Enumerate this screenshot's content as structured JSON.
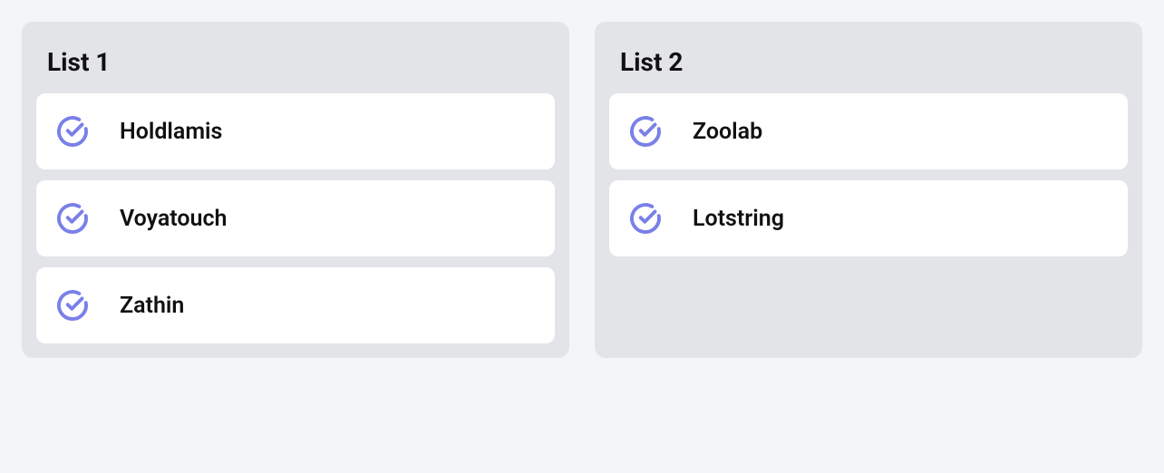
{
  "lists": [
    {
      "title": "List 1",
      "items": [
        {
          "label": "Holdlamis"
        },
        {
          "label": "Voyatouch"
        },
        {
          "label": "Zathin"
        }
      ]
    },
    {
      "title": "List 2",
      "items": [
        {
          "label": "Zoolab"
        },
        {
          "label": "Lotstring"
        }
      ]
    }
  ],
  "colors": {
    "icon": "#7A80E8"
  }
}
